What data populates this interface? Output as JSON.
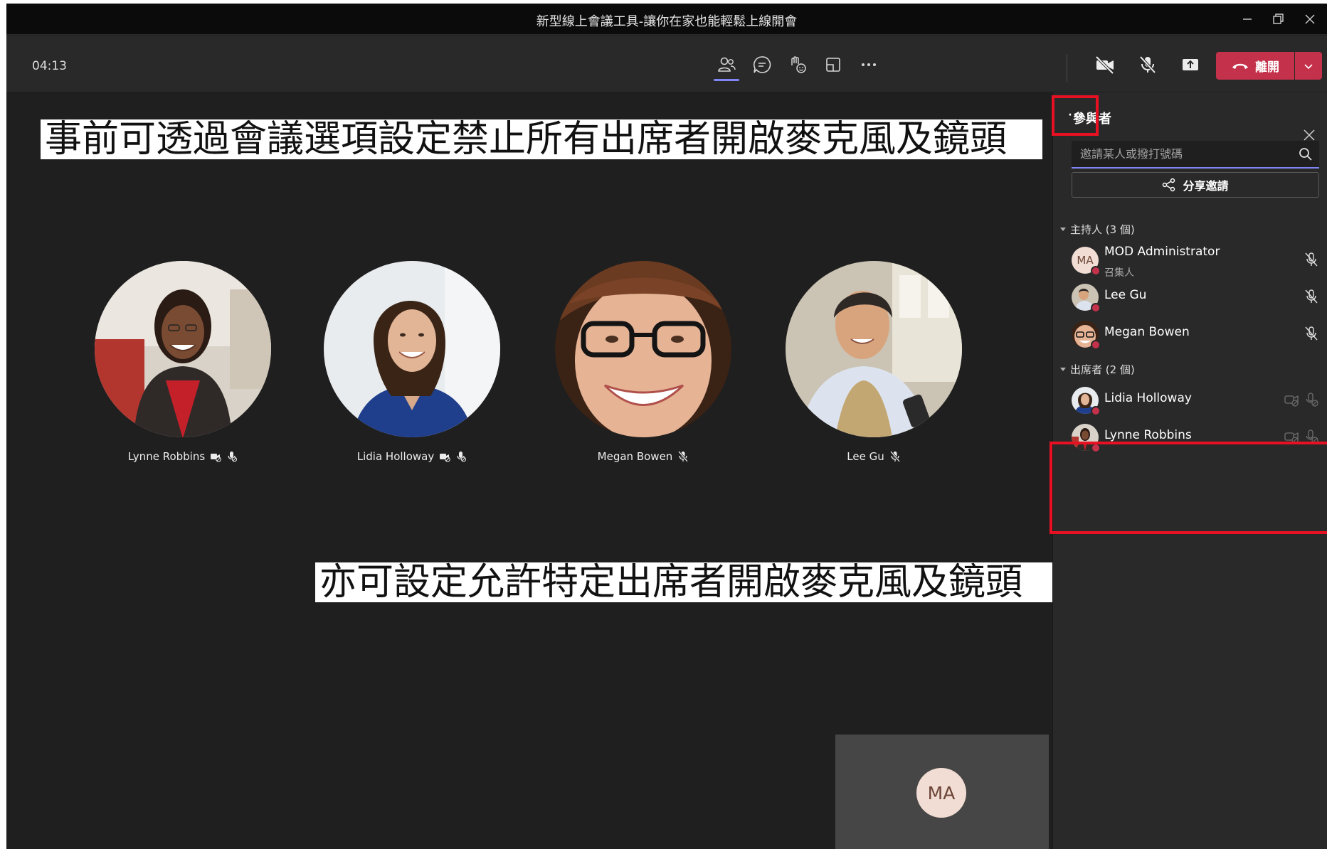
{
  "window": {
    "title": "新型線上會議工具-讓你在家也能輕鬆上線開會"
  },
  "toolbar": {
    "timer": "04:13",
    "buttons": [
      {
        "name": "participants-button",
        "icon": "people-icon"
      },
      {
        "name": "chat-button",
        "icon": "chat-icon"
      },
      {
        "name": "reactions-button",
        "icon": "raise-hand-icon"
      },
      {
        "name": "rooms-button",
        "icon": "breakout-rooms-icon"
      },
      {
        "name": "more-actions-button",
        "icon": "ellipsis-icon"
      },
      {
        "name": "camera-button",
        "icon": "camera-off-icon"
      },
      {
        "name": "mic-button",
        "icon": "mic-off-icon"
      },
      {
        "name": "share-button",
        "icon": "share-screen-icon"
      }
    ],
    "leave_label": "離開"
  },
  "captions": {
    "top": "事前可透過會議選項設定禁止所有出席者開啟麥克風及鏡頭",
    "bottom": "亦可設定允許特定出席者開啟麥克風及鏡頭"
  },
  "stage": {
    "tiles": [
      {
        "name": "Lynne Robbins",
        "status": [
          "camera-disabled-icon",
          "mic-disabled-icon"
        ]
      },
      {
        "name": "Lidia Holloway",
        "status": [
          "camera-disabled-icon",
          "mic-disabled-icon"
        ]
      },
      {
        "name": "Megan Bowen",
        "status": [
          "mic-off-icon"
        ]
      },
      {
        "name": "Lee Gu",
        "status": [
          "mic-off-icon"
        ]
      }
    ],
    "self_initials": "MA"
  },
  "panel": {
    "title": "參與者",
    "more_label": "···",
    "search_placeholder": "邀請某人或撥打號碼",
    "share_invite_label": "分享邀請",
    "presenters_header": "主持人 (3 個)",
    "attendees_header": "出席者 (2 個)",
    "presenters": [
      {
        "name": "MOD Administrator",
        "subtitle": "召集人",
        "initials": "MA"
      },
      {
        "name": "Lee Gu"
      },
      {
        "name": "Megan Bowen"
      }
    ],
    "attendees": [
      {
        "name": "Lidia Holloway"
      },
      {
        "name": "Lynne Robbins"
      }
    ]
  },
  "colors": {
    "accent": "#7f85f5",
    "leave": "#c4314b",
    "highlight": "#e81123",
    "background": "#1f1f1f",
    "panel": "#292929"
  }
}
